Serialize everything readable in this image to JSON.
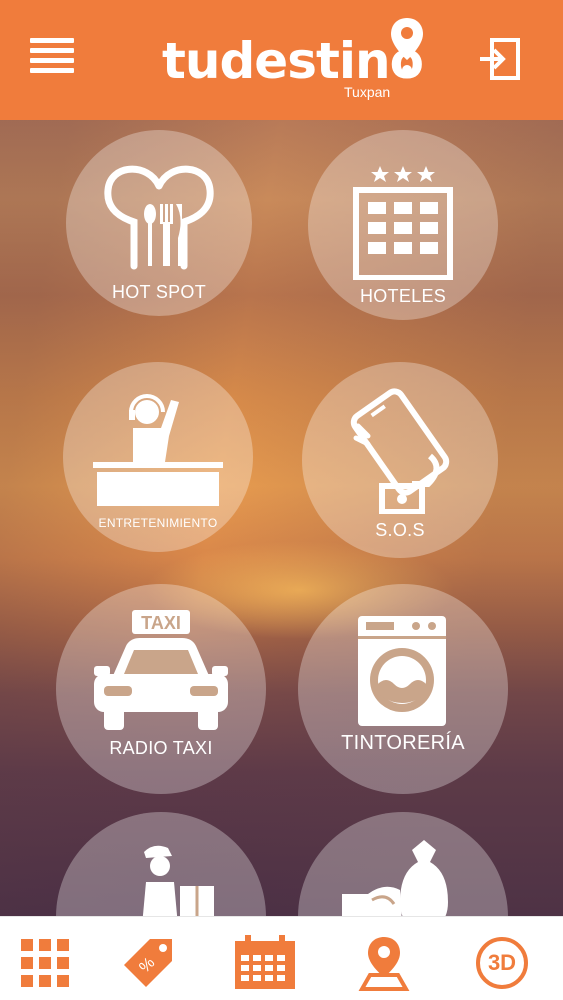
{
  "header": {
    "brand": "tudestino",
    "city": "Tuxpan",
    "menu_icon": "hamburger-menu-icon",
    "logout_icon": "logout-icon"
  },
  "categories": [
    {
      "label": "HOT SPOT",
      "icon": "restaurant-cutlery-icon"
    },
    {
      "label": "HOTELES",
      "icon": "hotel-building-icon"
    },
    {
      "label": "ENTRETENIMIENTO",
      "icon": "dj-turntable-icon"
    },
    {
      "label": "S.O.S",
      "icon": "phone-in-hand-icon"
    },
    {
      "label": "RADIO TAXI",
      "icon": "taxi-icon"
    },
    {
      "label": "TINTORERÍA",
      "icon": "washing-machine-icon"
    },
    {
      "label": "",
      "icon": "delivery-person-icon"
    },
    {
      "label": "",
      "icon": "money-bag-hand-icon"
    }
  ],
  "tabbar": {
    "items": [
      {
        "icon": "grid-icon"
      },
      {
        "icon": "discount-tag-icon"
      },
      {
        "icon": "calendar-icon"
      },
      {
        "icon": "map-pin-icon"
      },
      {
        "icon": "3d-icon",
        "label": "3D"
      }
    ]
  },
  "colors": {
    "accent": "#f07c3c",
    "tile_overlay": "rgba(255,255,255,0.30)",
    "text_light": "#ffffff"
  }
}
